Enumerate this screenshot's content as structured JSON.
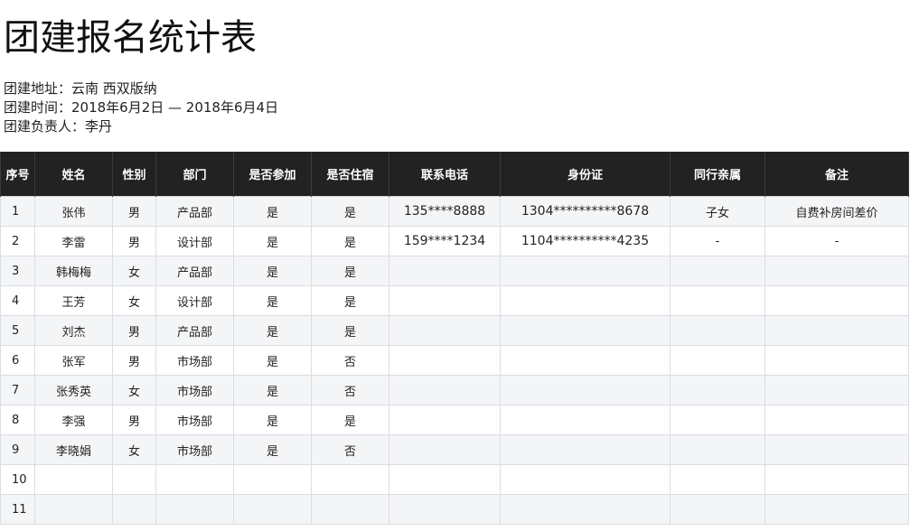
{
  "title": "团建报名统计表",
  "info": {
    "location": "团建地址：云南 西双版纳",
    "time": "团建时间：2018年6月2日 — 2018年6月4日",
    "leader": "团建负责人：李丹"
  },
  "table": {
    "headers": [
      "序号",
      "姓名",
      "性别",
      "部门",
      "是否参加",
      "是否住宿",
      "联系电话",
      "身份证",
      "同行亲属",
      "备注"
    ],
    "rows": [
      [
        "1",
        "张伟",
        "男",
        "产品部",
        "是",
        "是",
        "135****8888",
        "1304**********8678",
        "子女",
        "自费补房间差价"
      ],
      [
        "2",
        "李雷",
        "男",
        "设计部",
        "是",
        "是",
        "159****1234",
        "1104**********4235",
        "-",
        "-"
      ],
      [
        "3",
        "韩梅梅",
        "女",
        "产品部",
        "是",
        "是",
        "",
        "",
        "",
        ""
      ],
      [
        "4",
        "王芳",
        "女",
        "设计部",
        "是",
        "是",
        "",
        "",
        "",
        ""
      ],
      [
        "5",
        "刘杰",
        "男",
        "产品部",
        "是",
        "是",
        "",
        "",
        "",
        ""
      ],
      [
        "6",
        "张军",
        "男",
        "市场部",
        "是",
        "否",
        "",
        "",
        "",
        ""
      ],
      [
        "7",
        "张秀英",
        "女",
        "市场部",
        "是",
        "否",
        "",
        "",
        "",
        ""
      ],
      [
        "8",
        "李强",
        "男",
        "市场部",
        "是",
        "是",
        "",
        "",
        "",
        ""
      ],
      [
        "9",
        "李晓娟",
        "女",
        "市场部",
        "是",
        "否",
        "",
        "",
        "",
        ""
      ],
      [
        "10",
        "",
        "",
        "",
        "",
        "",
        "",
        "",
        "",
        ""
      ],
      [
        "11",
        "",
        "",
        "",
        "",
        "",
        "",
        "",
        "",
        ""
      ]
    ]
  },
  "colors": {
    "header_background": "#222222",
    "header_text": "#ffffff",
    "row_stripe": "#f4f5f7",
    "grid_line": "#dadde2"
  }
}
